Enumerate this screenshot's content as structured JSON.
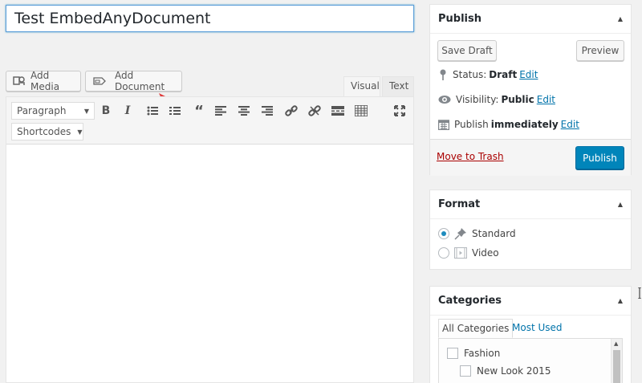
{
  "post": {
    "title": "Test EmbedAnyDocument"
  },
  "media": {
    "add_media": "Add Media",
    "add_document": "Add Document"
  },
  "editor": {
    "tab_visual": "Visual",
    "tab_text": "Text",
    "format_select": "Paragraph",
    "shortcodes_select": "Shortcodes",
    "icons": [
      "bold-icon",
      "italic-icon",
      "bulleted-list-icon",
      "numbered-list-icon",
      "blockquote-icon",
      "align-left-icon",
      "align-center-icon",
      "align-right-icon",
      "link-icon",
      "unlink-icon",
      "read-more-icon",
      "toolbar-toggle-icon",
      "fullscreen-icon"
    ]
  },
  "publish": {
    "title": "Publish",
    "save_draft": "Save Draft",
    "preview": "Preview",
    "status_label": "Status:",
    "status_value": "Draft",
    "visibility_label": "Visibility:",
    "visibility_value": "Public",
    "publish_label": "Publish",
    "publish_value": "immediately",
    "edit": "Edit",
    "move_to_trash": "Move to Trash",
    "publish_button": "Publish"
  },
  "format": {
    "title": "Format",
    "options": [
      {
        "label": "Standard",
        "checked": true
      },
      {
        "label": "Video",
        "checked": false
      }
    ]
  },
  "categories": {
    "title": "Categories",
    "tab_all": "All Categories",
    "tab_most_used": "Most Used",
    "items": [
      {
        "label": "Fashion",
        "checked": false
      },
      {
        "label": "New Look 2015",
        "checked": false
      }
    ]
  },
  "colors": {
    "accent": "#0085ba",
    "link": "#0073aa",
    "trash": "#a00000",
    "arrow": "#e03b3b"
  }
}
